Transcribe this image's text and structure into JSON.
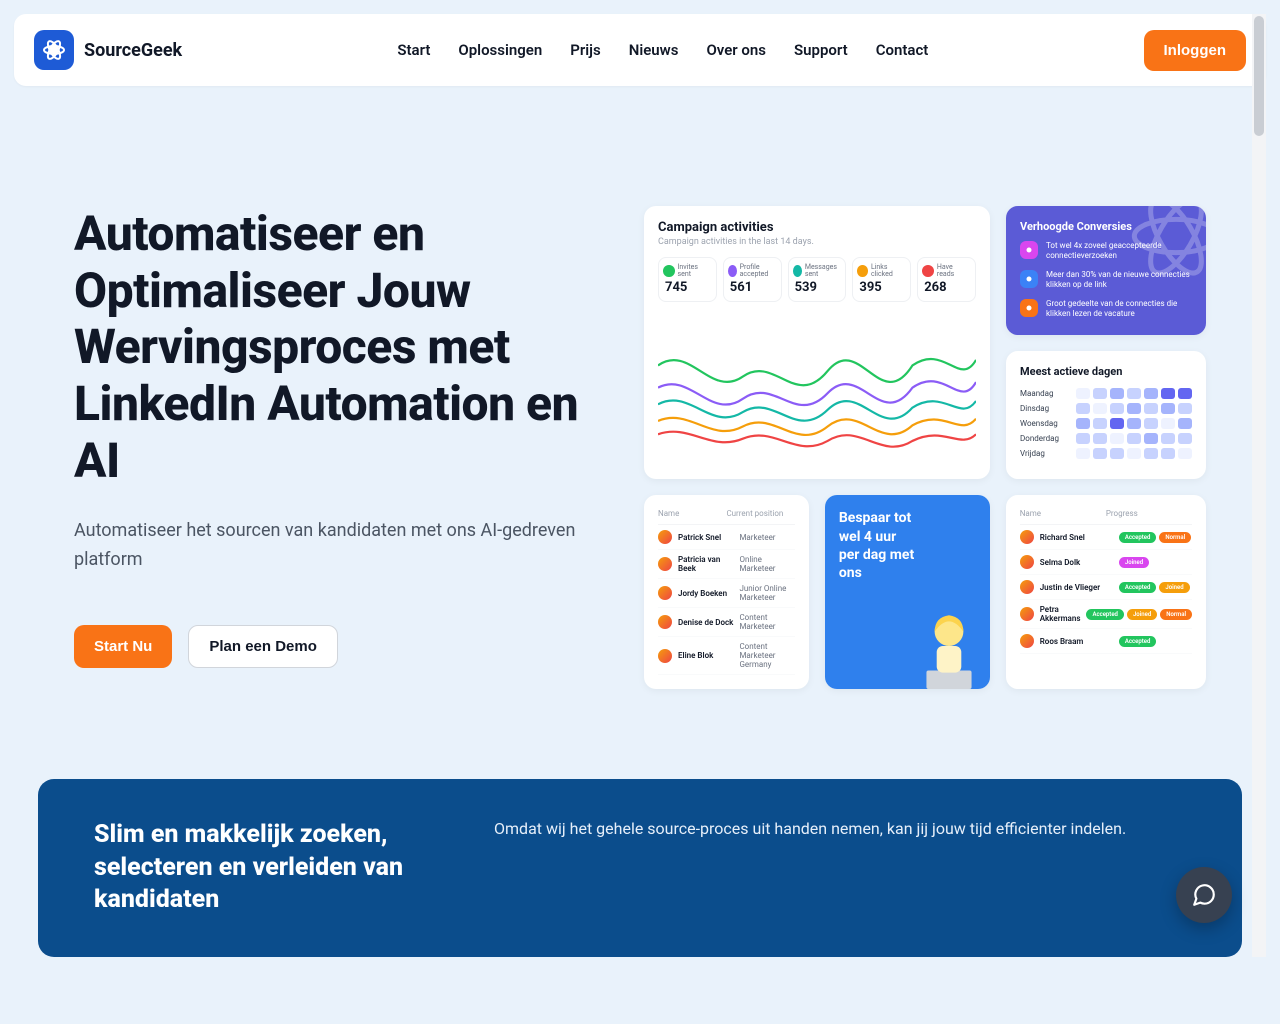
{
  "brand": {
    "name": "SourceGeek"
  },
  "nav": {
    "items": [
      "Start",
      "Oplossingen",
      "Prijs",
      "Nieuws",
      "Over ons",
      "Support",
      "Contact"
    ],
    "login": "Inloggen"
  },
  "hero": {
    "title": "Automatiseer en Optimaliseer Jouw Wervingsproces met LinkedIn Automation en AI",
    "subtitle": "Automatiseer het sourcen van kandidaten met ons AI-gedreven platform",
    "cta_primary": "Start Nu",
    "cta_secondary": "Plan een Demo"
  },
  "campaign": {
    "title": "Campaign activities",
    "subtitle": "Campaign activities in the last 14 days.",
    "stats": [
      {
        "label": "Invites sent",
        "value": "745",
        "color": "#22c55e"
      },
      {
        "label": "Profile accepted",
        "value": "561",
        "color": "#8b5cf6"
      },
      {
        "label": "Messages sent",
        "value": "539",
        "color": "#14b8a6"
      },
      {
        "label": "Links clicked",
        "value": "395",
        "color": "#f59e0b"
      },
      {
        "label": "Have reads",
        "value": "268",
        "color": "#ef4444"
      }
    ]
  },
  "conversions": {
    "title": "Verhoogde Conversies",
    "items": [
      {
        "text": "Tot wel 4x zoveel geaccepteerde connectieverzoeken",
        "color": "#d946ef"
      },
      {
        "text": "Meer dan 30% van de nieuwe connecties klikken op de link",
        "color": "#3b82f6"
      },
      {
        "text": "Groot gedeelte van de connecties die klikken lezen de vacature",
        "color": "#f97316"
      }
    ]
  },
  "active_days": {
    "title": "Meest actieve dagen",
    "days": [
      "Maandag",
      "Dinsdag",
      "Woensdag",
      "Donderdag",
      "Vrijdag"
    ],
    "intensity": [
      [
        0,
        1,
        2,
        1,
        2,
        3,
        3
      ],
      [
        1,
        0,
        1,
        2,
        1,
        2,
        1
      ],
      [
        2,
        1,
        3,
        2,
        1,
        0,
        2
      ],
      [
        1,
        1,
        0,
        1,
        2,
        1,
        1
      ],
      [
        0,
        1,
        1,
        0,
        1,
        1,
        0
      ]
    ],
    "scale": [
      "#eef2ff",
      "#c7d2fe",
      "#a5b4fc",
      "#6366f1"
    ]
  },
  "people": {
    "head_name": "Name",
    "head_pos": "Current position",
    "rows": [
      {
        "name": "Patrick Snel",
        "position": "Marketeer"
      },
      {
        "name": "Patricia van Beek",
        "position": "Online Marketeer"
      },
      {
        "name": "Jordy Boeken",
        "position": "Junior Online Marketeer"
      },
      {
        "name": "Denise de Dock",
        "position": "Content Marketeer"
      },
      {
        "name": "Eline Blok",
        "position": "Content Marketeer Germany"
      }
    ]
  },
  "save_time": {
    "text": "Bespaar tot wel 4 uur per dag met ons"
  },
  "progress": {
    "head_name": "Name",
    "head_prog": "Progress",
    "rows": [
      {
        "name": "Richard Snel",
        "badges": [
          {
            "t": "Accepted",
            "c": "#22c55e"
          },
          {
            "t": "Normal",
            "c": "#f97316"
          }
        ]
      },
      {
        "name": "Selma Dolk",
        "badges": [
          {
            "t": "Joined",
            "c": "#d946ef"
          }
        ]
      },
      {
        "name": "Justin de Vlieger",
        "badges": [
          {
            "t": "Accepted",
            "c": "#22c55e"
          },
          {
            "t": "Joined",
            "c": "#f59e0b"
          }
        ]
      },
      {
        "name": "Petra Akkermans",
        "badges": [
          {
            "t": "Accepted",
            "c": "#22c55e"
          },
          {
            "t": "Joined",
            "c": "#f59e0b"
          },
          {
            "t": "Normal",
            "c": "#f97316"
          }
        ]
      },
      {
        "name": "Roos Braam",
        "badges": [
          {
            "t": "Accepted",
            "c": "#22c55e"
          }
        ]
      }
    ]
  },
  "band": {
    "title": "Slim en makkelijk zoeken, selecteren en verleiden van kandidaten",
    "text": "Omdat wij het gehele source-proces uit handen nemen, kan jij jouw tijd efficienter indelen."
  }
}
